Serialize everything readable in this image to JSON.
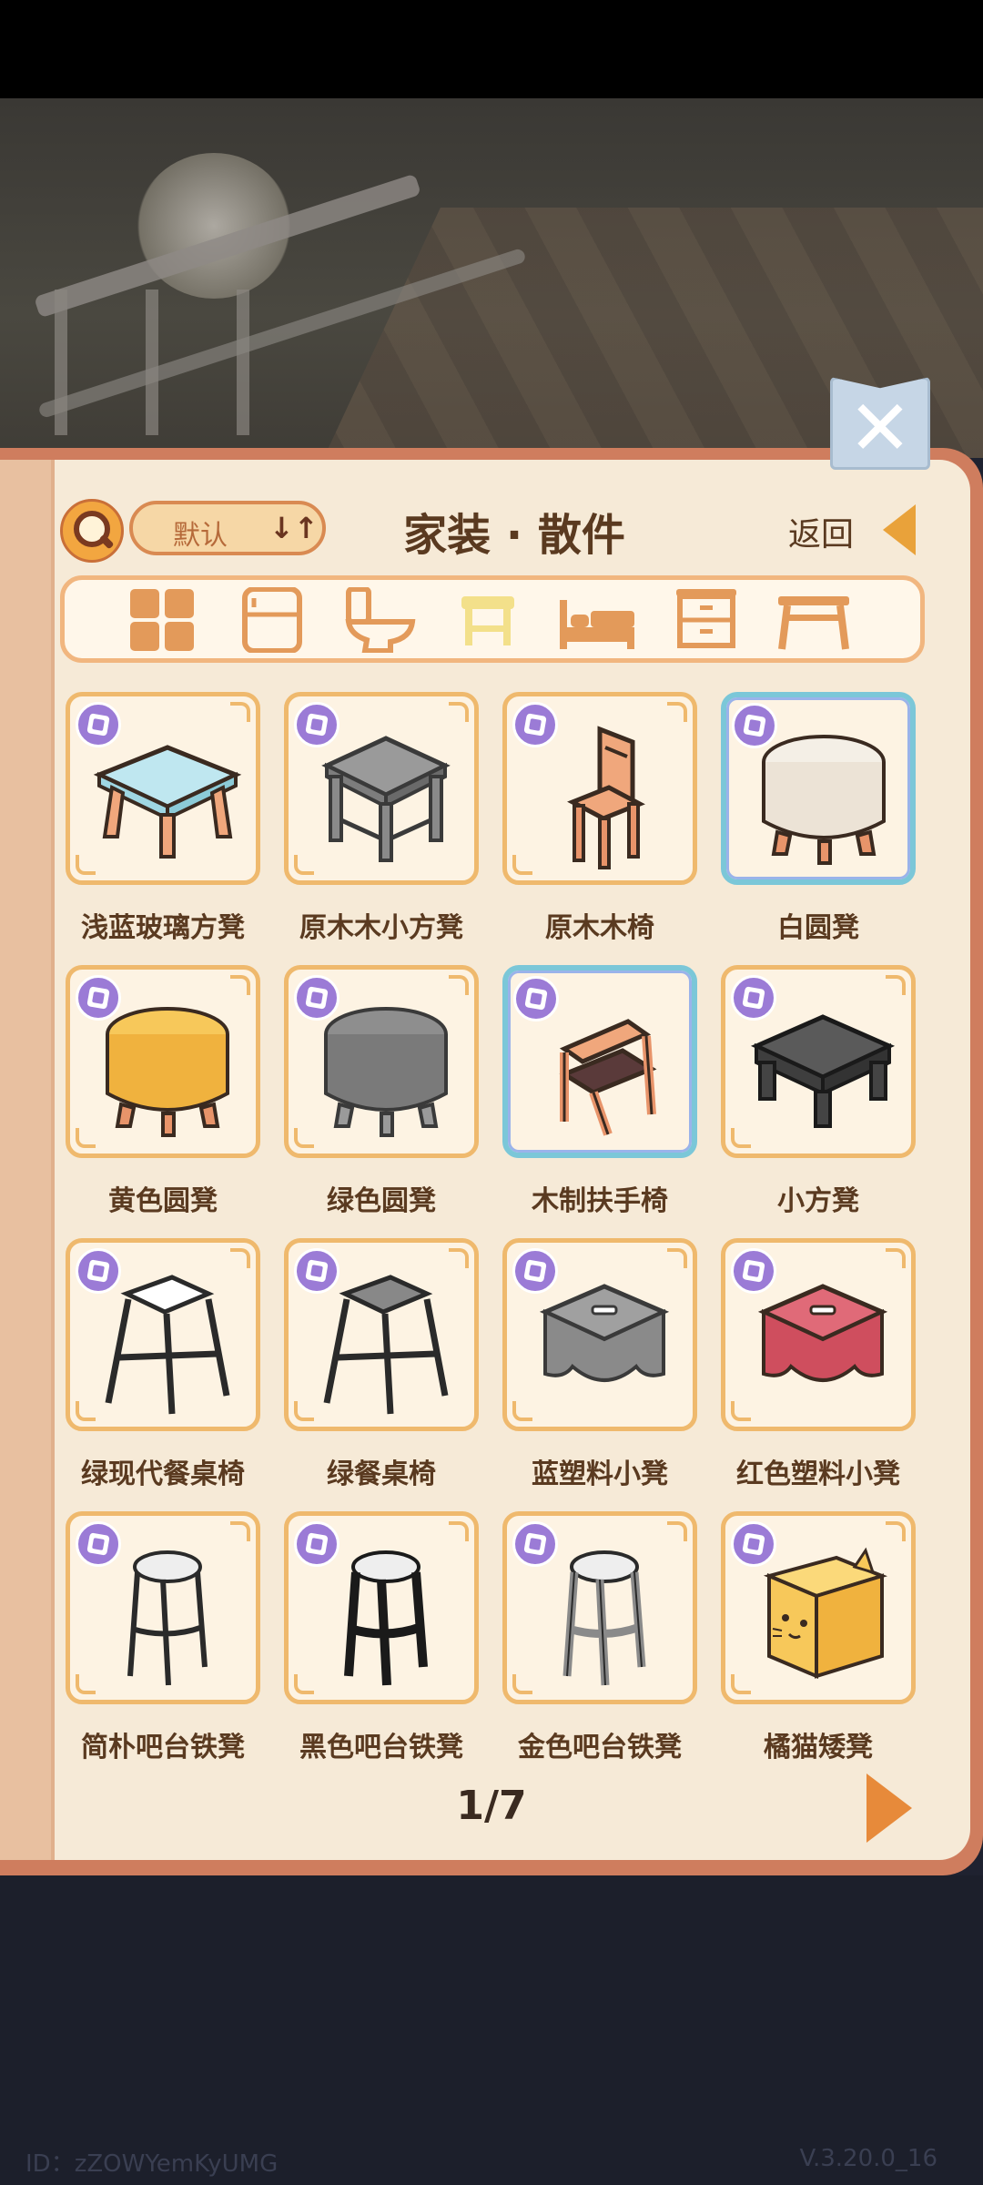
{
  "header": {
    "sort_label": "默认",
    "sort_icon": "↓↑",
    "title": "家装 · 散件",
    "back_label": "返回"
  },
  "categories": [
    {
      "name": "all-grid-icon",
      "active": false
    },
    {
      "name": "fridge-icon",
      "active": false
    },
    {
      "name": "toilet-icon",
      "active": false
    },
    {
      "name": "stool-icon",
      "active": true
    },
    {
      "name": "bed-icon",
      "active": false
    },
    {
      "name": "cabinet-icon",
      "active": false
    },
    {
      "name": "table-icon",
      "active": false
    }
  ],
  "items": [
    {
      "name": "浅蓝玻璃方凳",
      "icon": "glass-square-stool-icon",
      "selected": false
    },
    {
      "name": "原木木小方凳",
      "icon": "grey-square-stool-icon",
      "selected": false
    },
    {
      "name": "原木木椅",
      "icon": "wooden-chair-icon",
      "selected": false
    },
    {
      "name": "白圆凳",
      "icon": "white-round-stool-icon",
      "selected": true
    },
    {
      "name": "黄色圆凳",
      "icon": "yellow-round-stool-icon",
      "selected": false
    },
    {
      "name": "绿色圆凳",
      "icon": "grey-round-stool-icon",
      "selected": false
    },
    {
      "name": "木制扶手椅",
      "icon": "wooden-armchair-icon",
      "selected": true
    },
    {
      "name": "小方凳",
      "icon": "black-square-stool-icon",
      "selected": false
    },
    {
      "name": "绿现代餐桌椅",
      "icon": "white-bar-stool-icon",
      "selected": false
    },
    {
      "name": "绿餐桌椅",
      "icon": "grey-bar-stool-icon",
      "selected": false
    },
    {
      "name": "蓝塑料小凳",
      "icon": "grey-plastic-stool-icon",
      "selected": false
    },
    {
      "name": "红色塑料小凳",
      "icon": "red-plastic-stool-icon",
      "selected": false
    },
    {
      "name": "简朴吧台铁凳",
      "icon": "white-tall-stool-icon",
      "selected": false
    },
    {
      "name": "黑色吧台铁凳",
      "icon": "black-tall-stool-icon",
      "selected": false
    },
    {
      "name": "金色吧台铁凳",
      "icon": "silver-tall-stool-icon",
      "selected": false
    },
    {
      "name": "橘猫矮凳",
      "icon": "orange-cat-stool-icon",
      "selected": false
    }
  ],
  "pager": {
    "text": "1/7"
  },
  "footer": {
    "id": "ID：zZOWYemKyUMG",
    "version": "V.3.20.0_16"
  },
  "colors": {
    "accent": "#efb96d",
    "selected": "#7bc7d8",
    "badge": "#9b7bd6",
    "title": "#5a3a20"
  }
}
